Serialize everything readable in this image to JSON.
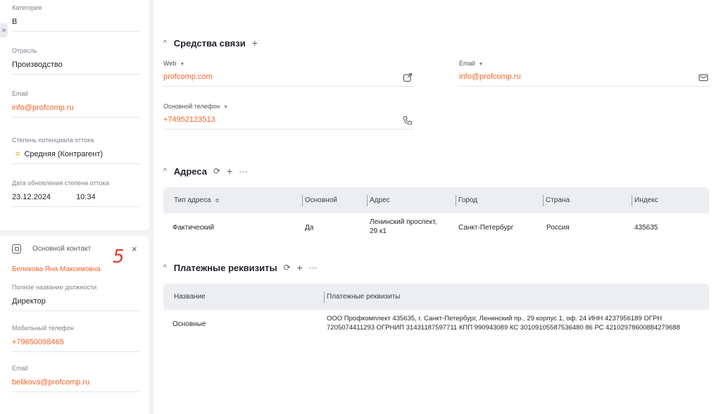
{
  "left": {
    "expand_icon": "»",
    "fields": [
      {
        "label": "Категория",
        "value": "B"
      },
      {
        "label": "Отрасль",
        "value": "Производство"
      },
      {
        "label": "Email",
        "value": "info@profcomp.ru"
      },
      {
        "label": "Степень потенциала оттока",
        "value": "Средняя (Контрагент)",
        "marker": "="
      },
      {
        "label": "Дата обновления степени оттока",
        "date": "23.12.2024",
        "time": "10:34"
      }
    ]
  },
  "contact": {
    "title": "Основной контакт",
    "name": "Беликова Яна Максимовна",
    "close_icon": "×",
    "annotation": "5",
    "fields": [
      {
        "label": "Полное название должности",
        "value": "Директор"
      },
      {
        "label": "Мобильный телефон",
        "value": "+79650098465"
      },
      {
        "label": "Email",
        "value": "belikova@profcomp.ru"
      }
    ]
  },
  "comm": {
    "title": "Средства связи",
    "chev": "^",
    "add": "+",
    "web": {
      "label": "Web",
      "value": "profcomp.com",
      "icon": "external-link-icon"
    },
    "email": {
      "label": "Email",
      "value": "info@profcomp.ru",
      "icon": "mail-icon"
    },
    "phone": {
      "label": "Основной телефон",
      "value": "+74952123513",
      "icon": "phone-icon"
    }
  },
  "addresses": {
    "title": "Адреса",
    "chev": "^",
    "tools": {
      "refresh": "⟳",
      "add": "+",
      "more": "···"
    },
    "columns": [
      "Тип адреса",
      "Основной",
      "Адрес",
      "Город",
      "Страна",
      "Индекс"
    ],
    "rows": [
      {
        "type": "Фактический",
        "main": "Да",
        "address_l1": "Ленинский проспект,",
        "address_l2": "29 к1",
        "city": "Санкт-Петербург",
        "country": "Россия",
        "index": "435635"
      }
    ]
  },
  "payments": {
    "title": "Платежные реквизиты",
    "chev": "^",
    "tools": {
      "refresh": "⟳",
      "add": "+",
      "more": "···"
    },
    "columns": [
      "Название",
      "Платежные реквизиты"
    ],
    "rows": [
      {
        "name": "Основные",
        "details_l1": "ООО Профкомплект 435635, г. Санкт-Петербург, Ленинский пр., 29 корпус 1, оф. 24 ИНН 4237956189 ОГРН",
        "details_l2": "7205074411293 ОГРНИП 31431187597711 КПП 990943089 КС 30109105587536480 86 РС 42102978600884279688"
      }
    ]
  }
}
